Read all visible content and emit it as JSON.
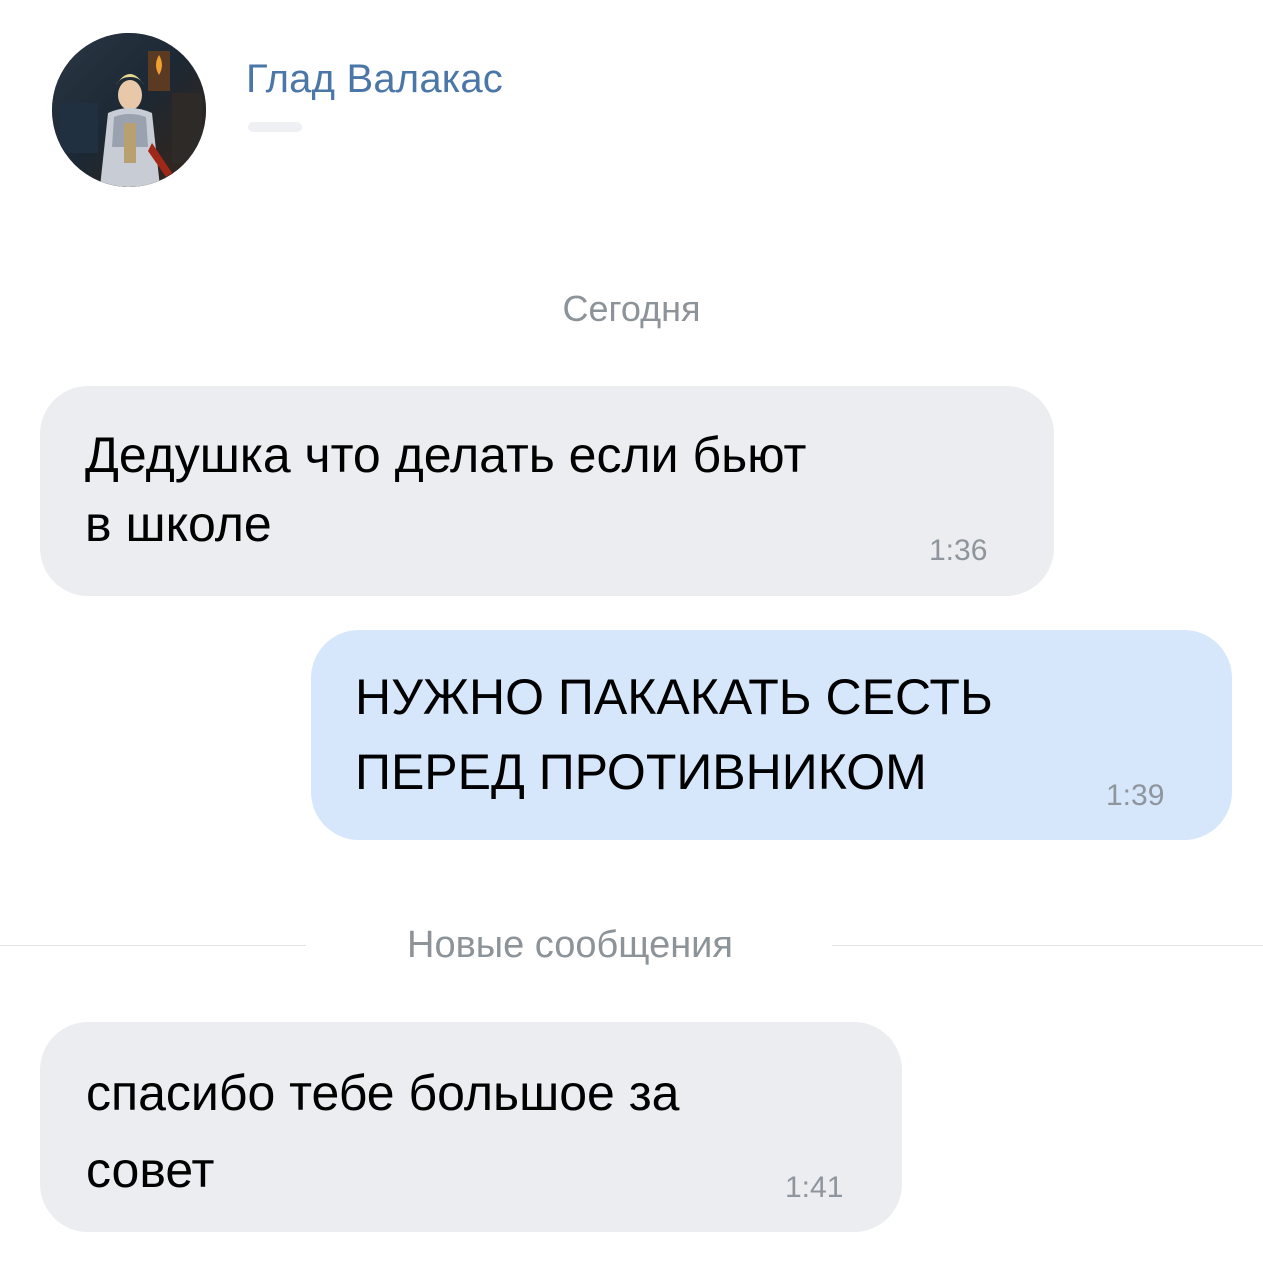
{
  "header": {
    "contact_name": "Глад Валакас",
    "avatar_icon": "user-avatar-icon"
  },
  "chat": {
    "day_separator": "Сегодня",
    "new_messages_label": "Новые сообщения",
    "messages": [
      {
        "direction": "incoming",
        "lines": [
          "Дедушка что делать если бьют",
          "в школе"
        ],
        "time": "1:36"
      },
      {
        "direction": "outgoing",
        "lines": [
          "НУЖНО ПАКАКАТЬ СЕСТЬ",
          "ПЕРЕД ПРОТИВНИКОМ"
        ],
        "time": "1:39"
      },
      {
        "direction": "incoming",
        "lines": [
          "спасибо тебе большое за",
          "совет"
        ],
        "time": "1:41"
      }
    ]
  },
  "colors": {
    "accent": "#4a76a8",
    "incoming_bubble": "#ebedf0",
    "outgoing_bubble": "#d6e7fb",
    "meta_text": "#8c9399"
  }
}
